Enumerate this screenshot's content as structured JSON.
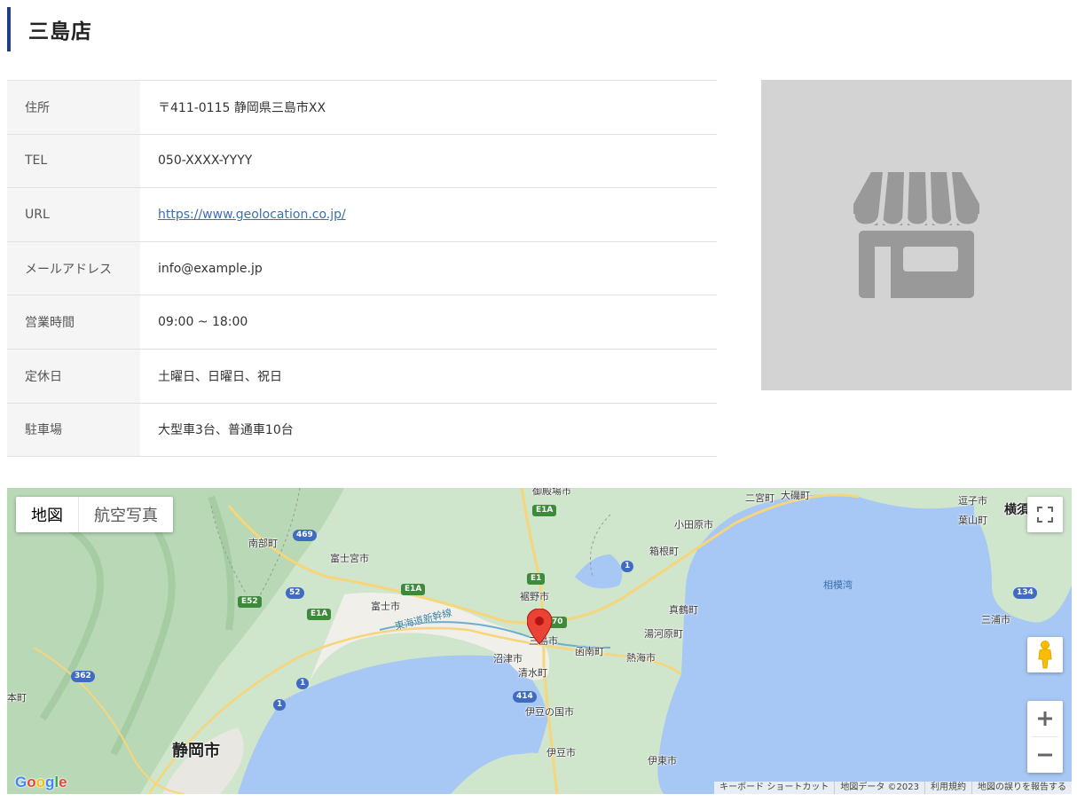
{
  "page": {
    "title": "三島店"
  },
  "store_info": {
    "rows": [
      {
        "label": "住所",
        "value": "〒411-0115 静岡県三島市XX"
      },
      {
        "label": "TEL",
        "value": "050-XXXX-YYYY"
      },
      {
        "label": "URL",
        "value": "https://www.geolocation.co.jp/"
      },
      {
        "label": "メールアドレス",
        "value": "info@example.jp"
      },
      {
        "label": "営業時間",
        "value": "09:00 ~ 18:00"
      },
      {
        "label": "定休日",
        "value": "土曜日、日曜日、祝日"
      },
      {
        "label": "駐車場",
        "value": "大型車3台、普通車10台"
      }
    ]
  },
  "store_image": {
    "icon": "storefront-icon",
    "colors": {
      "background": "#d3d3d3",
      "icon": "#999999"
    }
  },
  "map": {
    "type_buttons": {
      "map": "地図",
      "satellite": "航空写真"
    },
    "labels": {
      "gotemba": "御殿場市",
      "oiso": "大磯町",
      "ninomiya": "二宮町",
      "zushi": "逗子市",
      "hayama": "葉山町",
      "yokosuka": "横須",
      "odawara": "小田原市",
      "nanbu": "南部町",
      "fujinomiya": "富士宮市",
      "hakone": "箱根町",
      "sagamiwan": "相模湾",
      "susono": "裾野市",
      "fuji": "富士市",
      "manazuru": "真鶴町",
      "mishima": "三島市",
      "yugawara": "湯河原町",
      "miura": "三浦市",
      "kannami": "函南町",
      "numazu": "沼津市",
      "atami": "熱海市",
      "shimizu": "清水町",
      "shinkansen": "東海道新幹線",
      "izunokuni": "伊豆の国市",
      "shizuoka": "静岡市",
      "hon": "本町",
      "izu": "伊豆市",
      "ito": "伊東市"
    },
    "shields": {
      "e1a_top": "E1A",
      "e1": "E1",
      "e1a_mid": "E1A",
      "e1a_left": "E1A",
      "e52": "E52",
      "r469": "469",
      "r52": "52",
      "r1_hakone": "1",
      "r1_coast": "1",
      "r1_shimizu": "1",
      "r362": "362",
      "r414": "414",
      "r134": "134",
      "r70": "70"
    },
    "attribution": [
      "キーボード ショートカット",
      "地図データ ©2023",
      "利用規約",
      "地図の誤りを報告する"
    ],
    "logo": "Google"
  }
}
